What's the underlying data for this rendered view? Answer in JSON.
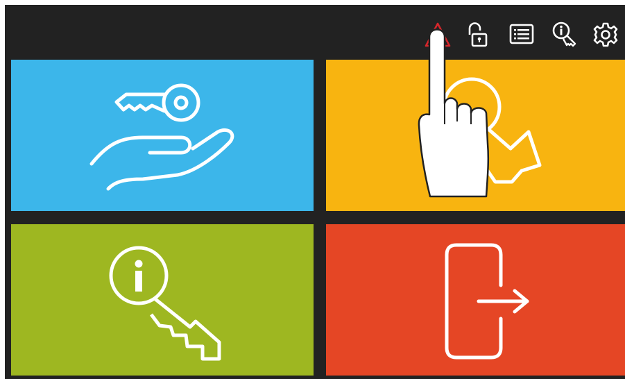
{
  "colors": {
    "background": "#222222",
    "tile_handover": "#3cb6ea",
    "tile_return": "#f8b410",
    "tile_info": "#9eb721",
    "tile_exit": "#e54625",
    "icon_stroke": "#ffffff",
    "warning": "#d7262b"
  },
  "toolbar": {
    "icons": [
      "warning-icon",
      "unlock-icon",
      "list-icon",
      "key-info-icon",
      "settings-icon"
    ]
  },
  "tiles": [
    {
      "id": "handover",
      "icon": "hand-key-icon"
    },
    {
      "id": "return",
      "icon": "key-return-icon"
    },
    {
      "id": "info",
      "icon": "key-info-icon"
    },
    {
      "id": "exit",
      "icon": "exit-door-icon"
    }
  ],
  "overlay": {
    "icon": "pointing-hand-icon"
  }
}
